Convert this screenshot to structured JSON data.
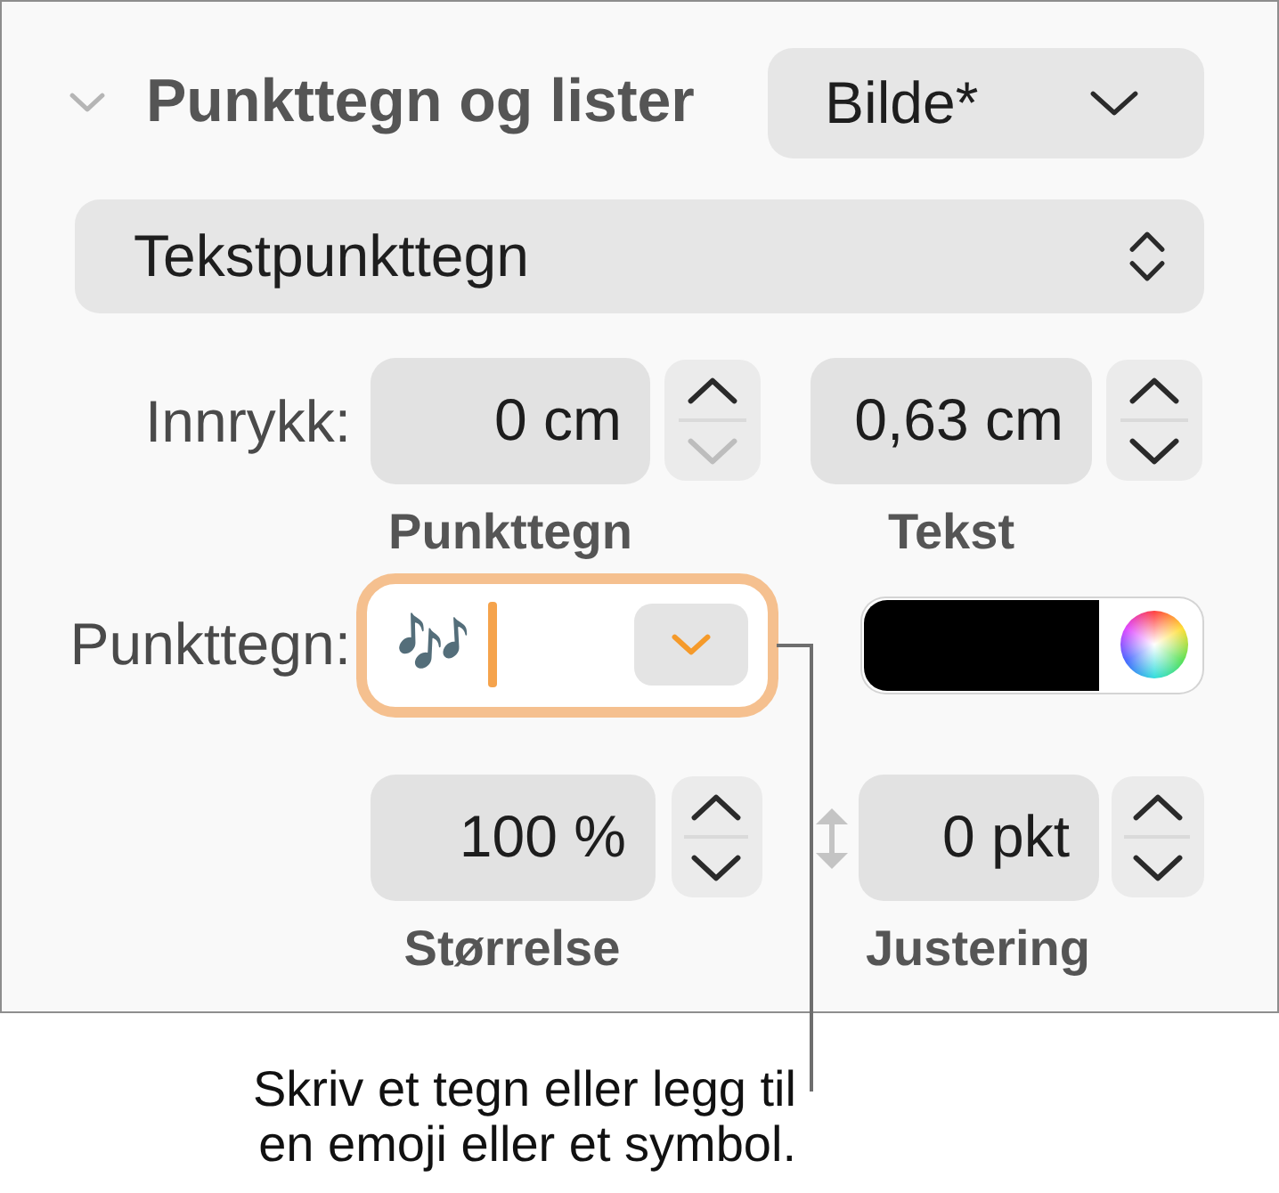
{
  "section": {
    "title": "Punkttegn og lister",
    "expanded": true,
    "style_popup": {
      "label": "Bilde*",
      "kind": "pulldown"
    }
  },
  "bullet_type_popup": {
    "label": "Tekstpunkttegn",
    "kind": "popup"
  },
  "indent": {
    "label": "Innrykk:",
    "fields": [
      {
        "kind": "plain",
        "value": "0 cm",
        "caption": "Punkttegn",
        "decrement_disabled": true
      },
      {
        "kind": "plain",
        "value": "0,63 cm",
        "caption": "Tekst",
        "decrement_disabled": false
      }
    ]
  },
  "bullet": {
    "label": "Punkttegn:",
    "value": "🎶",
    "focused": true,
    "color_well": {
      "color": "#000000"
    }
  },
  "size_alignment": {
    "fields": [
      {
        "kind": "plain",
        "value": "100 %",
        "caption": "Størrelse",
        "decrement_disabled": false
      },
      {
        "kind": "offset",
        "value": "0 pkt",
        "caption": "Justering",
        "decrement_disabled": false
      }
    ]
  },
  "callout": {
    "text": "Skriv et tegn eller legg til en emoji eller et symbol."
  }
}
